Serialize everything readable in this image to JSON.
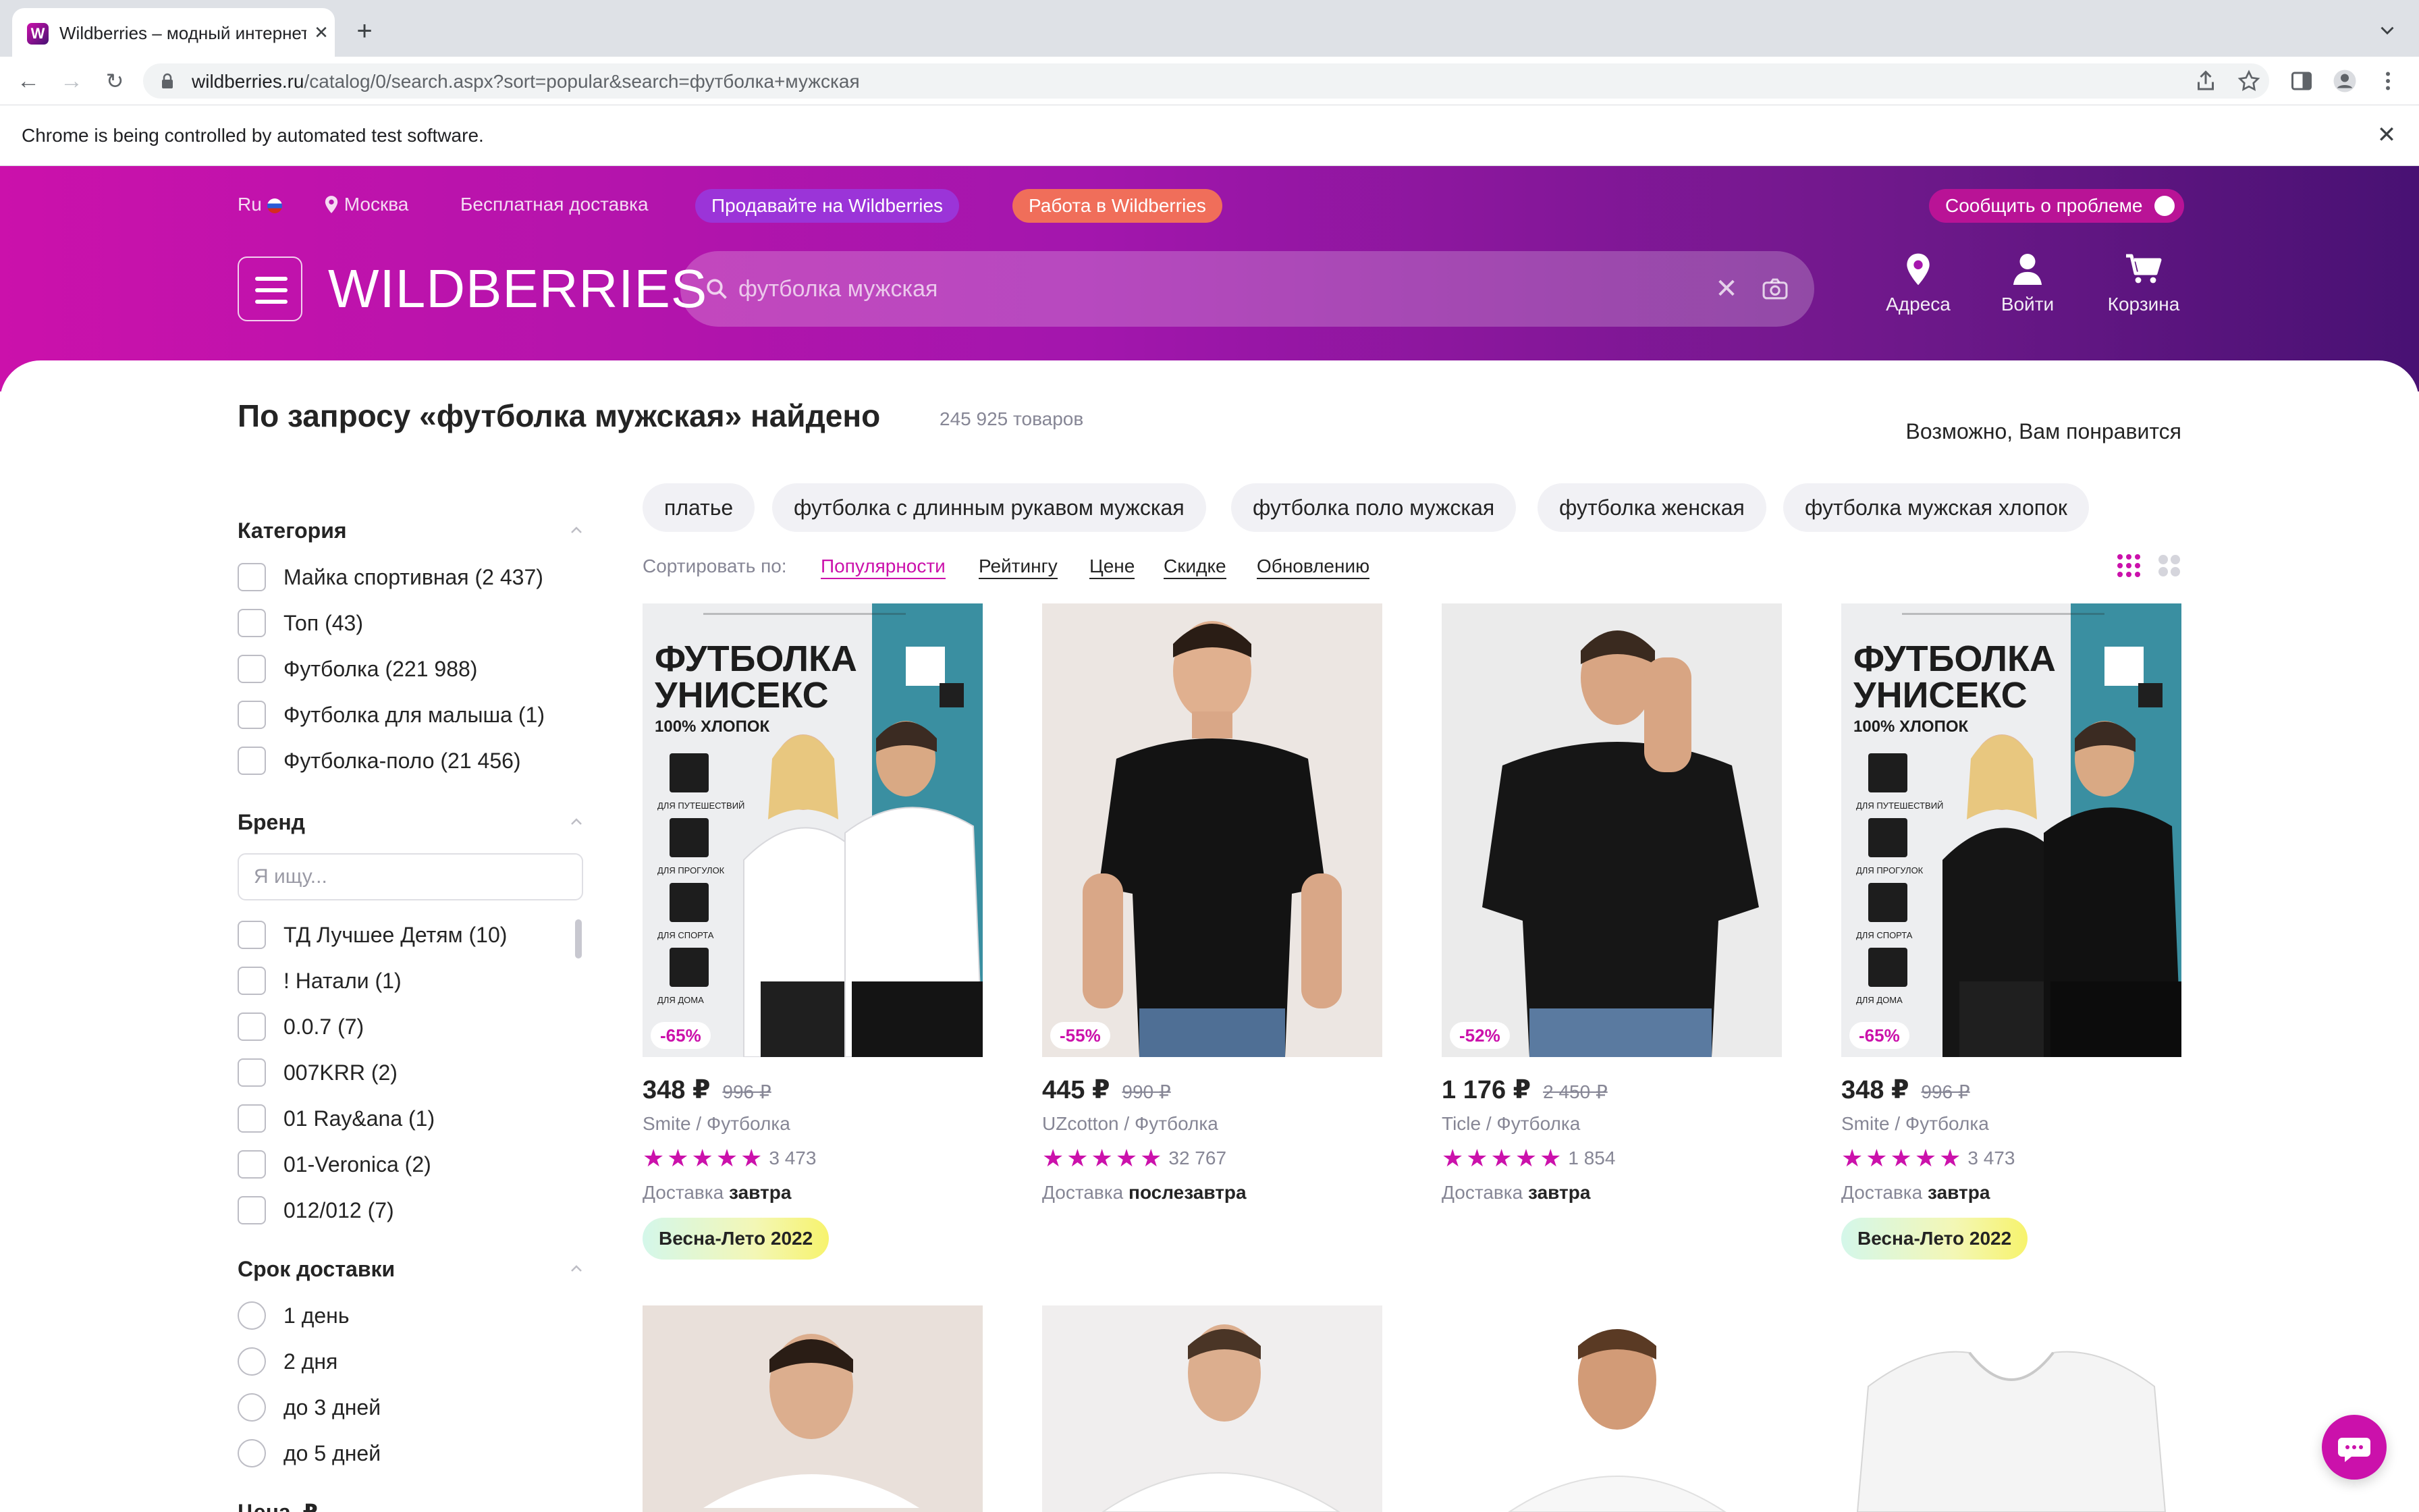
{
  "browser": {
    "tab_title": "Wildberries – модный интернет-магазин",
    "url_host": "wildberries.ru",
    "url_path": "/catalog/0/search.aspx?sort=popular&search=футболка+мужская",
    "automation_notice": "Chrome is being controlled by automated test software.",
    "favicon_letter": "W"
  },
  "header": {
    "lang": "Ru",
    "city": "Москва",
    "free_delivery": "Бесплатная доставка",
    "sell_pill": "Продавайте на Wildberries",
    "work_pill": "Работа в Wildberries",
    "report_pill": "Сообщить о проблеме",
    "logo": "WILDBERRIES",
    "search_value": "футболка мужская",
    "actions": {
      "addresses": "Адреса",
      "login": "Войти",
      "cart": "Корзина"
    },
    "colors": {
      "brand": "#cb11ab",
      "brand_dark": "#481173",
      "work_pill": "#f06e5a"
    }
  },
  "results": {
    "title": "По запросу «футболка мужская» найдено",
    "count": "245 925 товаров",
    "maybe_like": "Возможно, Вам понравится",
    "tags": [
      "платье",
      "футболка с длинным рукавом мужская",
      "футболка поло мужская",
      "футболка женская",
      "футболка мужская хлопок"
    ],
    "sort_label": "Сортировать по:",
    "sort_options": [
      "Популярности",
      "Рейтингу",
      "Цене",
      "Скидке",
      "Обновлению"
    ],
    "sort_active": "Популярности"
  },
  "filters": {
    "category": {
      "title": "Категория",
      "items": [
        "Майка спортивная (2 437)",
        "Топ (43)",
        "Футболка (221 988)",
        "Футболка для малыша (1)",
        "Футболка-поло (21 456)"
      ]
    },
    "brand": {
      "title": "Бренд",
      "placeholder": "Я ищу...",
      "items": [
        "ТД Лучшее Детям (10)",
        "! Натали (1)",
        "0.0.7 (7)",
        "007KRR (2)",
        "01 Ray&ana (1)",
        "01-Veronica (2)",
        "012/012 (7)"
      ]
    },
    "delivery": {
      "title": "Срок доставки",
      "items": [
        "1 день",
        "2 дня",
        "до 3 дней",
        "до 5 дней"
      ]
    },
    "next_title": "Цена, ₽"
  },
  "products": [
    {
      "price": "348 ₽",
      "old_price": "996 ₽",
      "discount": "-65%",
      "brand": "Smite / Футболка",
      "stars": "★★★★★",
      "reviews": "3 473",
      "delivery_label": "Доставка",
      "delivery_value": "завтра",
      "season": "Весна-Лето 2022",
      "poster_line1": "ФУТБОЛКА",
      "poster_line2": "УНИСЕКС",
      "poster_line3": "100% ХЛОПОК",
      "poster_icons": [
        "ДЛЯ ПУТЕШЕСТВИЙ",
        "ДЛЯ ПРОГУЛОК",
        "ДЛЯ СПОРТА",
        "ДЛЯ ДОМА"
      ]
    },
    {
      "price": "445 ₽",
      "old_price": "990 ₽",
      "discount": "-55%",
      "brand": "UZcotton / Футболка",
      "stars": "★★★★★",
      "reviews": "32 767",
      "delivery_label": "Доставка",
      "delivery_value": "послезавтра"
    },
    {
      "price": "1 176 ₽",
      "old_price": "2 450 ₽",
      "discount": "-52%",
      "brand": "Ticle / Футболка",
      "stars": "★★★★★",
      "reviews": "1 854",
      "delivery_label": "Доставка",
      "delivery_value": "завтра"
    },
    {
      "price": "348 ₽",
      "old_price": "996 ₽",
      "discount": "-65%",
      "brand": "Smite / Футболка",
      "stars": "★★★★★",
      "reviews": "3 473",
      "delivery_label": "Доставка",
      "delivery_value": "завтра",
      "season": "Весна-Лето 2022",
      "poster_line1": "ФУТБОЛКА",
      "poster_line2": "УНИСЕКС",
      "poster_line3": "100% ХЛОПОК",
      "poster_icons": [
        "ДЛЯ ПУТЕШЕСТВИЙ",
        "ДЛЯ ПРОГУЛОК",
        "ДЛЯ СПОРТА",
        "ДЛЯ ДОМА"
      ]
    }
  ]
}
